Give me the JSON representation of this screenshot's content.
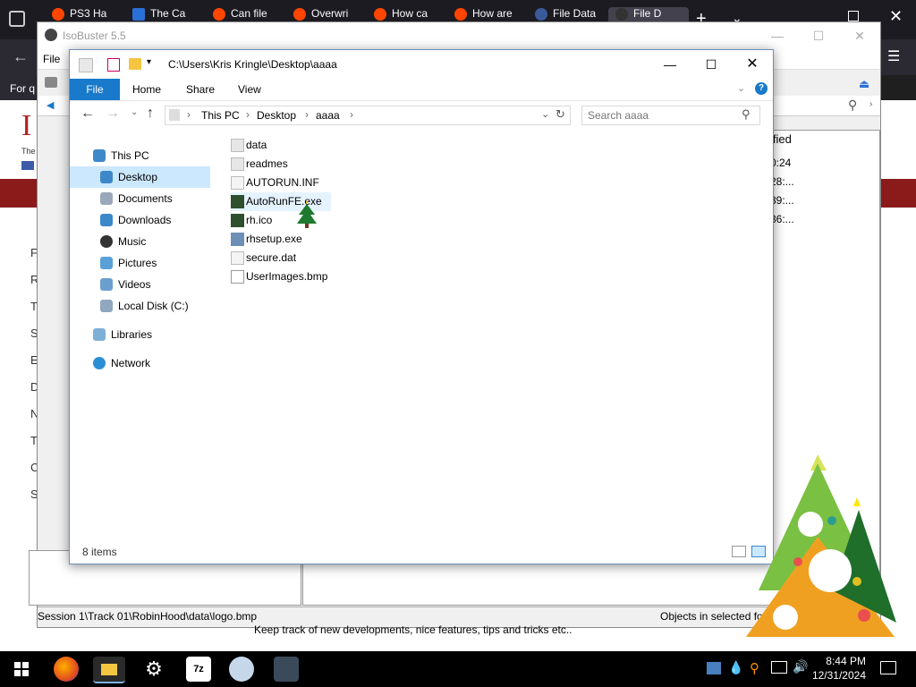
{
  "browser": {
    "tabs": [
      {
        "label": "PS3 Ha"
      },
      {
        "label": "The Ca"
      },
      {
        "label": "Can file"
      },
      {
        "label": "Overwri"
      },
      {
        "label": "How ca"
      },
      {
        "label": "How are"
      },
      {
        "label": "File Data"
      },
      {
        "label": "File D"
      }
    ],
    "bookmarks_fragment": "For q"
  },
  "webpage": {
    "side_letters": [
      "F",
      "R",
      "T",
      "S",
      "E",
      "D",
      "N",
      "T",
      "C",
      "S"
    ],
    "right_column_header": "ified",
    "right_column_values": [
      "0:24",
      "28:...",
      "39:...",
      "36:..."
    ],
    "bottom_text": "Keep track of new developments, nice features, tips and tricks etc.."
  },
  "isobuster": {
    "title": "IsoBuster 5.5",
    "menu_file": "File",
    "status_path": "Session 1\\Track 01\\RobinHood\\data\\logo.bmp",
    "status_right": "Objects in selected folder :"
  },
  "explorer": {
    "title_path": "C:\\Users\\Kris Kringle\\Desktop\\aaaa",
    "ribbon_tabs": [
      "File",
      "Home",
      "Share",
      "View"
    ],
    "breadcrumb": [
      "This PC",
      "Desktop",
      "aaaa"
    ],
    "search_placeholder": "Search aaaa",
    "nav": {
      "this_pc": "This PC",
      "items": [
        "Desktop",
        "Documents",
        "Downloads",
        "Music",
        "Pictures",
        "Videos",
        "Local Disk (C:)"
      ],
      "libraries": "Libraries",
      "network": "Network"
    },
    "files": [
      {
        "name": "data",
        "icon": "folder-icon"
      },
      {
        "name": "readmes",
        "icon": "folder-icon"
      },
      {
        "name": "AUTORUN.INF",
        "icon": "file-icon"
      },
      {
        "name": "AutoRunFE.exe",
        "icon": "exe-icon"
      },
      {
        "name": "rh.ico",
        "icon": "image-icon"
      },
      {
        "name": "rhsetup.exe",
        "icon": "setup-icon"
      },
      {
        "name": "secure.dat",
        "icon": "file-icon"
      },
      {
        "name": "UserImages.bmp",
        "icon": "bitmap-icon"
      }
    ],
    "item_count": "8 items"
  },
  "taskbar": {
    "time": "8:44 PM",
    "date": "12/31/2024"
  },
  "colors": {
    "accent_blue": "#1979ca",
    "selected_bg": "#cce8ff",
    "hover_bg": "#e5f3ff",
    "taskbar": "#000000",
    "browser_dark": "#1c1b22"
  }
}
